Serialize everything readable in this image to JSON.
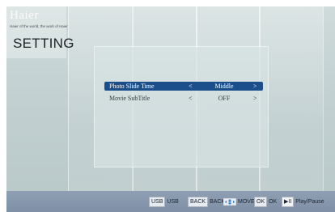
{
  "brand": {
    "logo": "Haier",
    "slogan": "Haier of the world, the work of Haier"
  },
  "page": {
    "title": "SETTING"
  },
  "menu": {
    "left_arrow": "<",
    "right_arrow": ">",
    "items": [
      {
        "label": "Photo Slide Time",
        "value": "Middle",
        "selected": true
      },
      {
        "label": "Movie SubTitle",
        "value": "OFF",
        "selected": false
      }
    ]
  },
  "bottom_bar": {
    "hints": [
      {
        "key": "USB",
        "action": "USB"
      },
      {
        "key": "BACK",
        "action": "BACK"
      },
      {
        "key": "move-arrows",
        "action": "MOVE"
      },
      {
        "key": "OK",
        "action": "OK"
      },
      {
        "key": "▶II",
        "action": "Play/Pause"
      }
    ]
  },
  "colors": {
    "selected_row": "#1b4f8c",
    "background": "#c2d0d1",
    "bottom_bar": "#8a9ab0"
  }
}
